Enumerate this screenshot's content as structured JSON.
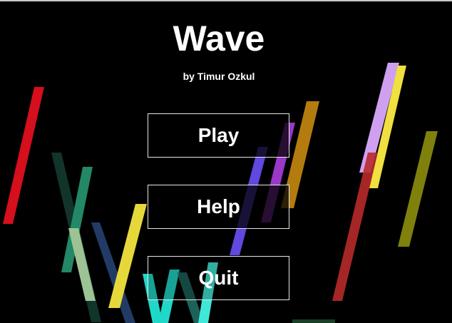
{
  "game": {
    "title": "Wave",
    "subtitle": "by Timur Ozkul"
  },
  "menu": {
    "play_label": "Play",
    "help_label": "Help",
    "quit_label": "Quit"
  },
  "colors": {
    "background": "#000000",
    "text": "#ffffff",
    "button_border": "#e6e6e6",
    "streaks": [
      "#e0101e",
      "#2aa07a",
      "#b9e6b0",
      "#3a6fc0",
      "#e6d83a",
      "#20d8c8",
      "#6048e0",
      "#9a38c8",
      "#c88a10",
      "#d0a0f0",
      "#f0e040",
      "#b82a2a",
      "#a0a010"
    ]
  }
}
